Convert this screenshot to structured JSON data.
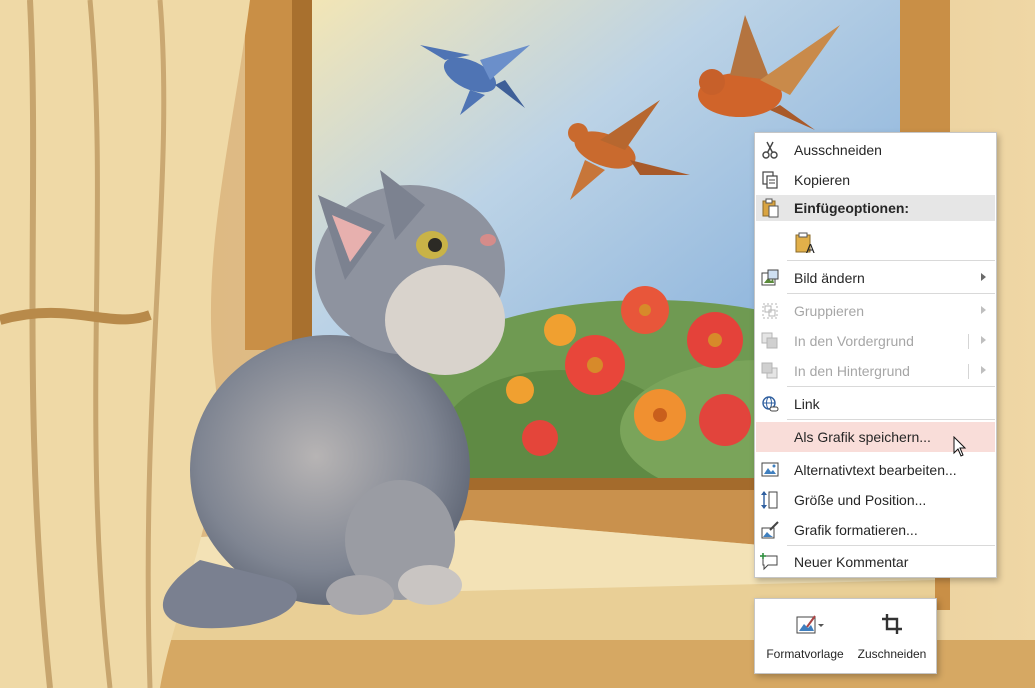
{
  "context_menu": {
    "cut": {
      "label": "Ausschneiden",
      "icon": "scissors-icon"
    },
    "copy": {
      "label": "Kopieren",
      "icon": "copy-icon"
    },
    "paste_options": {
      "label": "Einfügeoptionen:",
      "icon": "clipboard-icon"
    },
    "paste_picture": {
      "icon": "paste-picture-icon"
    },
    "change_picture": {
      "label": "Bild ändern",
      "icon": "change-picture-icon"
    },
    "group": {
      "label": "Gruppieren",
      "icon": "group-icon",
      "disabled": true
    },
    "bring_forward": {
      "label": "In den Vordergrund",
      "icon": "bring-forward-icon",
      "disabled": true
    },
    "send_backward": {
      "label": "In den Hintergrund",
      "icon": "send-backward-icon",
      "disabled": true
    },
    "link": {
      "label": "Link",
      "icon": "link-icon"
    },
    "save_as_picture": {
      "label": "Als Grafik speichern...",
      "highlighted": true
    },
    "alt_text": {
      "label": "Alternativtext bearbeiten...",
      "icon": "alt-text-icon"
    },
    "size_position": {
      "label": "Größe und Position...",
      "icon": "size-position-icon"
    },
    "format_picture": {
      "label": "Grafik formatieren...",
      "icon": "format-picture-icon"
    },
    "new_comment": {
      "label": "Neuer Kommentar",
      "icon": "comment-icon"
    }
  },
  "mini_toolbar": {
    "style": {
      "label": "Formatvorlage",
      "icon": "picture-style-icon"
    },
    "crop": {
      "label": "Zuschneiden",
      "icon": "crop-icon"
    }
  },
  "colors": {
    "highlight": "#f9ddd9",
    "header_bg": "#e6e6e6",
    "disabled_text": "#a6a6a6"
  }
}
